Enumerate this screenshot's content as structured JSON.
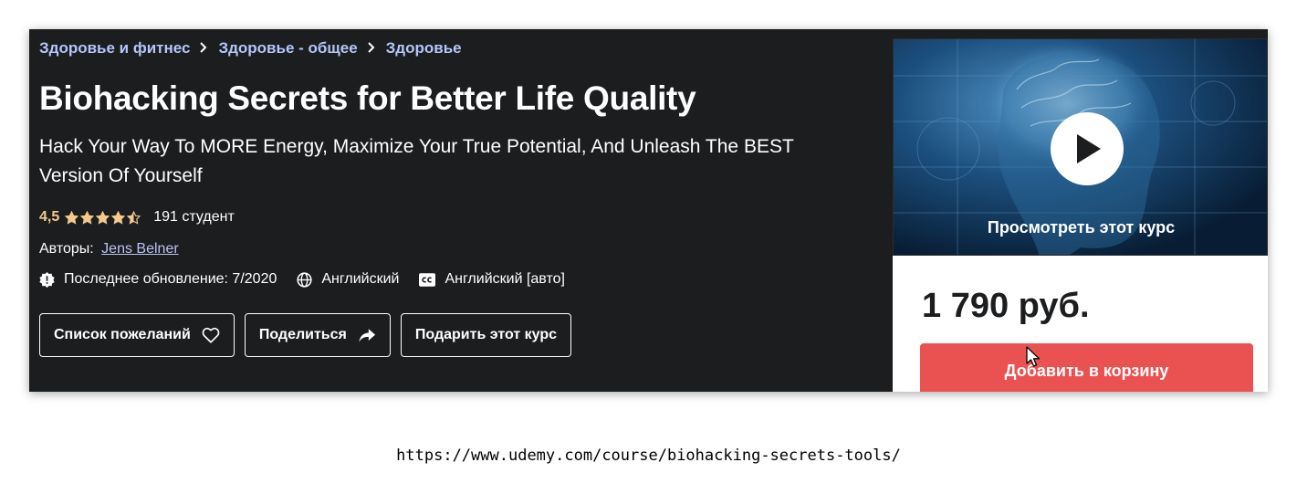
{
  "breadcrumb": [
    "Здоровье и фитнес",
    "Здоровье - общее",
    "Здоровье"
  ],
  "course": {
    "title": "Biohacking Secrets for Better Life Quality",
    "subtitle": "Hack Your Way To MORE Energy, Maximize Your True Potential, And Unleash The BEST Version Of Yourself",
    "rating": "4,5",
    "rating_stars": 4.5,
    "students": "191 студент",
    "authors_label": "Авторы:",
    "author": "Jens Belner",
    "last_updated": "Последнее обновление: 7/2020",
    "language": "Английский",
    "captions": "Английский [авто]"
  },
  "buttons": {
    "wishlist": "Список пожеланий",
    "share": "Поделиться",
    "gift": "Подарить этот курс"
  },
  "sidebar": {
    "preview_label": "Просмотреть этот курс",
    "price": "1 790 руб.",
    "add_to_cart": "Добавить в корзину"
  },
  "url": "https://www.udemy.com/course/biohacking-secrets-tools/",
  "colors": {
    "background": "#1c1d1f",
    "rating": "#f3ca8c",
    "cart_button": "#ea5252",
    "breadcrumb": "#b4c6fb"
  },
  "icons": [
    "chevron-right-icon",
    "star-icon",
    "alert-badge-icon",
    "globe-icon",
    "closed-captions-icon",
    "heart-icon",
    "share-arrow-icon",
    "play-icon",
    "mouse-cursor-icon"
  ]
}
